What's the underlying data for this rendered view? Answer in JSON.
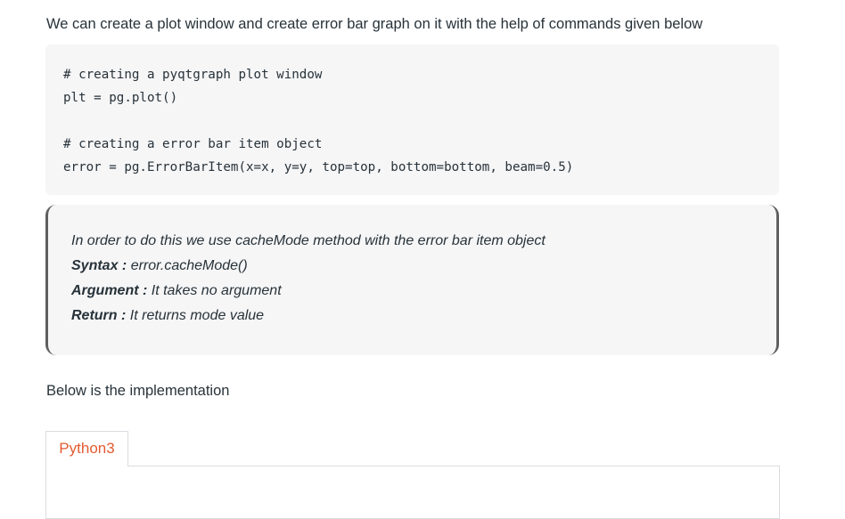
{
  "intro_text": "We can create a plot window and create error bar graph on it with the help of commands given below",
  "code": {
    "lines": [
      "# creating a pyqtgraph plot window",
      "plt = pg.plot()",
      "",
      "# creating a error bar item object",
      "error = pg.ErrorBarItem(x=x, y=y, top=top, bottom=bottom, beam=0.5)"
    ]
  },
  "note": {
    "description": "In order to do this we use cacheMode method with the error bar item object",
    "syntax_label": "Syntax :",
    "syntax_value": " error.cacheMode()",
    "argument_label": "Argument :",
    "argument_value": " It takes no argument",
    "return_label": "Return :",
    "return_value": " It returns mode value"
  },
  "implementation_text": "Below is the implementation",
  "tabs": [
    {
      "label": "Python3"
    }
  ],
  "colors": {
    "text": "#273239",
    "code_background": "#f6f6f7",
    "note_border": "#5f5f5f",
    "tab_accent": "#e35b32",
    "tab_border": "#d9dce0"
  }
}
